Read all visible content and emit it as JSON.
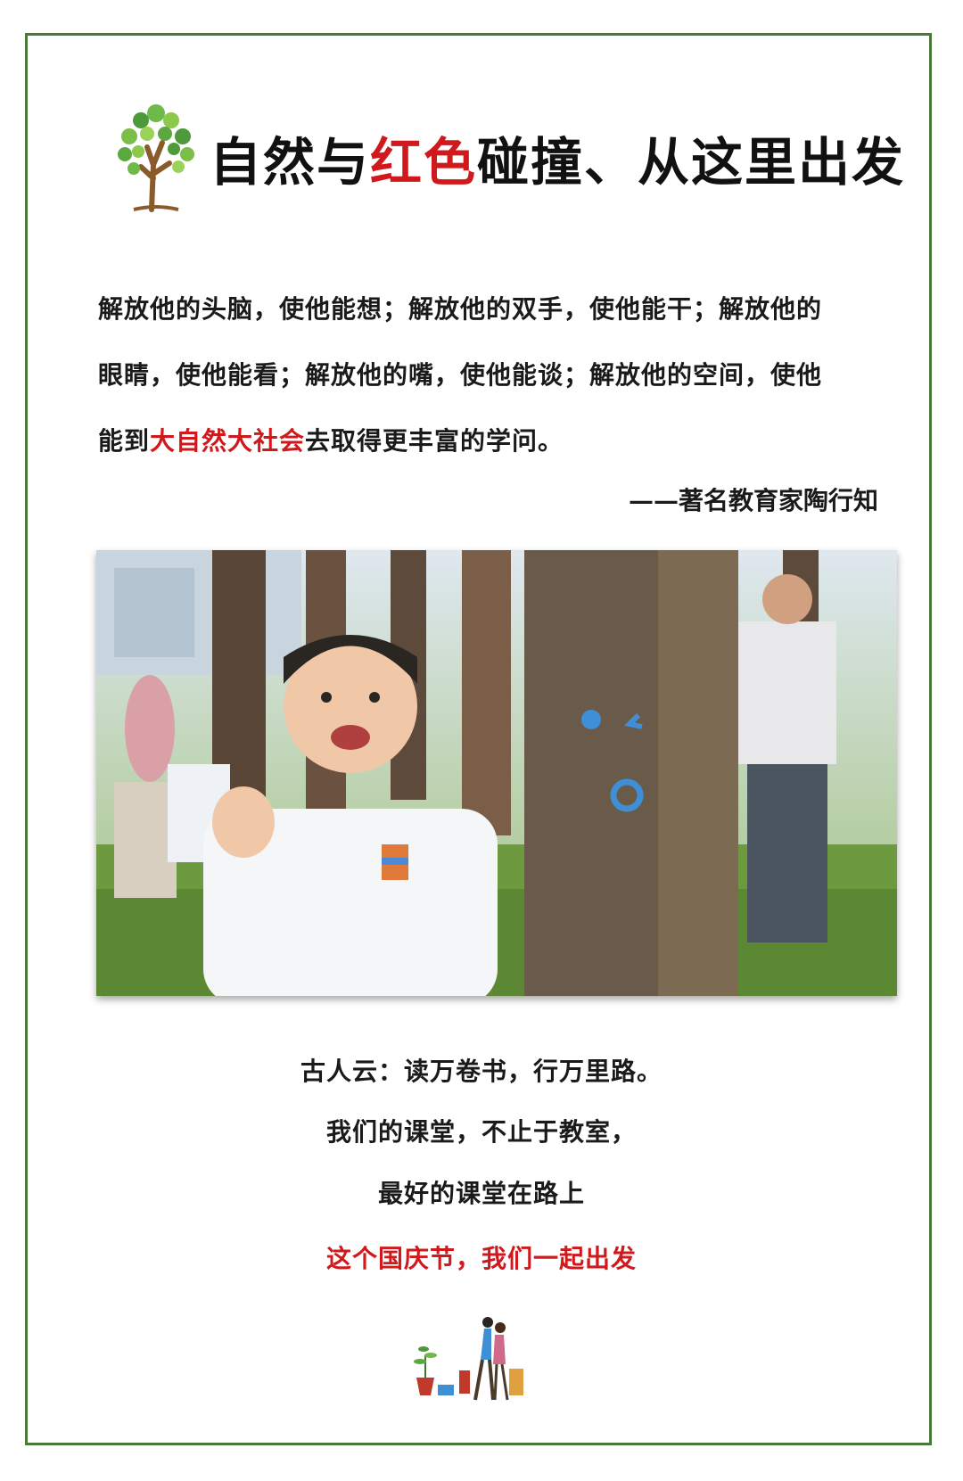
{
  "header": {
    "title_prefix": "自然与",
    "title_highlight": "红色",
    "title_suffix": "碰撞、从这里出发"
  },
  "quote": {
    "line1": "解放他的头脑，使他能想；解放他的双手，使他能干；解放他的",
    "line2": "眼睛，使他能看；解放他的嘴，使他能谈；解放他的空间，使他",
    "line3_prefix": "能到",
    "line3_highlight": "大自然大社会",
    "line3_suffix": "去取得更丰富的学问。",
    "attribution": "——著名教育家陶行知"
  },
  "verse": {
    "line1": "古人云：读万卷书，行万里路。",
    "line2": "我们的课堂，不止于教室，",
    "line3": "最好的课堂在路上",
    "line4": "这个国庆节，我们一起出发"
  },
  "colors": {
    "accent_red": "#d0191c",
    "frame_green": "#4a7a3a"
  },
  "icons": {
    "logo": "tree-logo-icon",
    "footer": "travelers-with-plant-icon"
  }
}
